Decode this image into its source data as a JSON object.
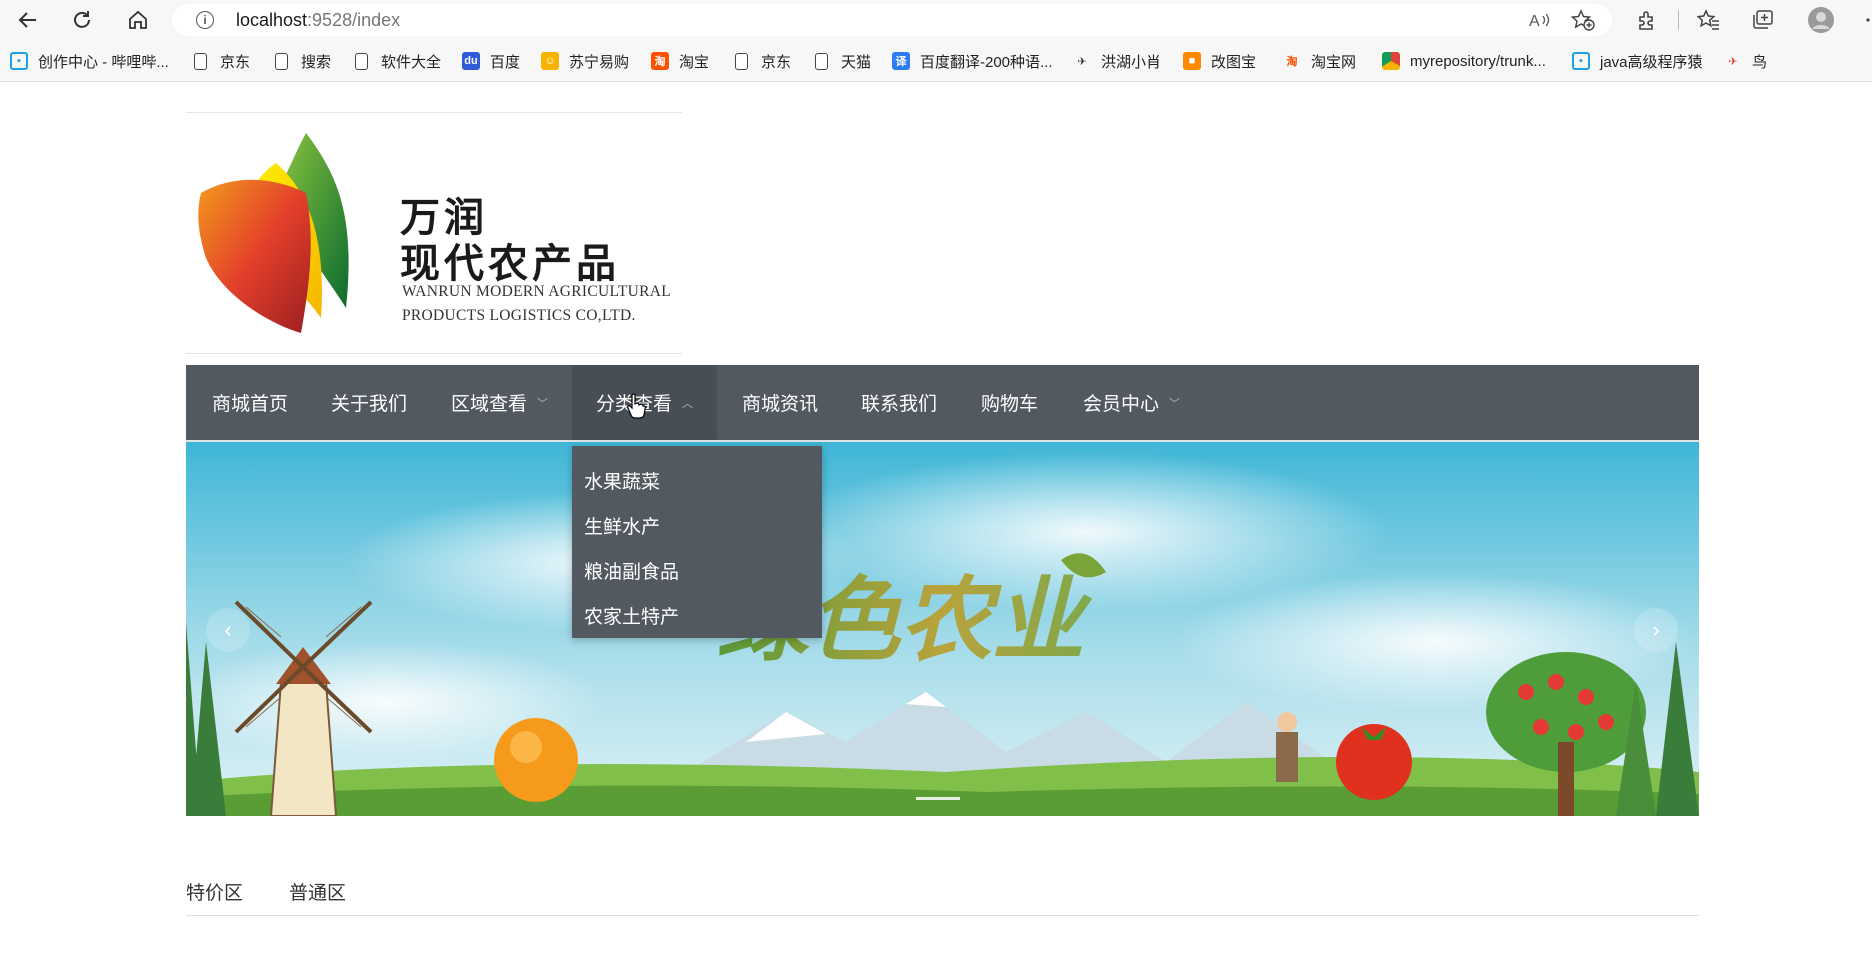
{
  "browser": {
    "url_host": "localhost",
    "url_path": ":9528/index",
    "bookmarks": [
      {
        "label": "创作中心 - 哔哩哔...",
        "icon": "bilibili-icon"
      },
      {
        "label": "京东",
        "icon": "page-icon"
      },
      {
        "label": "搜索",
        "icon": "page-icon"
      },
      {
        "label": "软件大全",
        "icon": "page-icon"
      },
      {
        "label": "百度",
        "icon": "baidu-icon"
      },
      {
        "label": "苏宁易购",
        "icon": "suning-icon"
      },
      {
        "label": "淘宝",
        "icon": "taobao-icon"
      },
      {
        "label": "京东",
        "icon": "page-icon"
      },
      {
        "label": "天猫",
        "icon": "page-icon"
      },
      {
        "label": "百度翻译-200种语...",
        "icon": "translate-icon"
      },
      {
        "label": "洪湖小肖",
        "icon": "bird-icon"
      },
      {
        "label": "改图宝",
        "icon": "gaitubao-icon"
      },
      {
        "label": "淘宝网",
        "icon": "taobao-icon"
      },
      {
        "label": "myrepository/trunk...",
        "icon": "chrome-icon"
      },
      {
        "label": "java高级程序猿",
        "icon": "bilibili-icon"
      },
      {
        "label": "鸟",
        "icon": "bird-red-icon"
      }
    ]
  },
  "logo": {
    "cn_line1": "万润",
    "cn_line2": "现代农产品",
    "en_line1": "WANRUN MODERN AGRICULTURAL",
    "en_line2": "PRODUCTS  LOGISTICS CO,LTD."
  },
  "menu": {
    "items": [
      {
        "label": "商城首页"
      },
      {
        "label": "关于我们"
      },
      {
        "label": "区域查看"
      },
      {
        "label": "分类查看"
      },
      {
        "label": "商城资讯"
      },
      {
        "label": "联系我们"
      },
      {
        "label": "购物车"
      },
      {
        "label": "会员中心"
      }
    ],
    "dropdown": [
      "水果蔬菜",
      "生鲜水产",
      "粮油副食品",
      "农家土特产"
    ]
  },
  "banner": {
    "title": "绿色农业"
  },
  "tabs": [
    "特价区",
    "普通区"
  ]
}
